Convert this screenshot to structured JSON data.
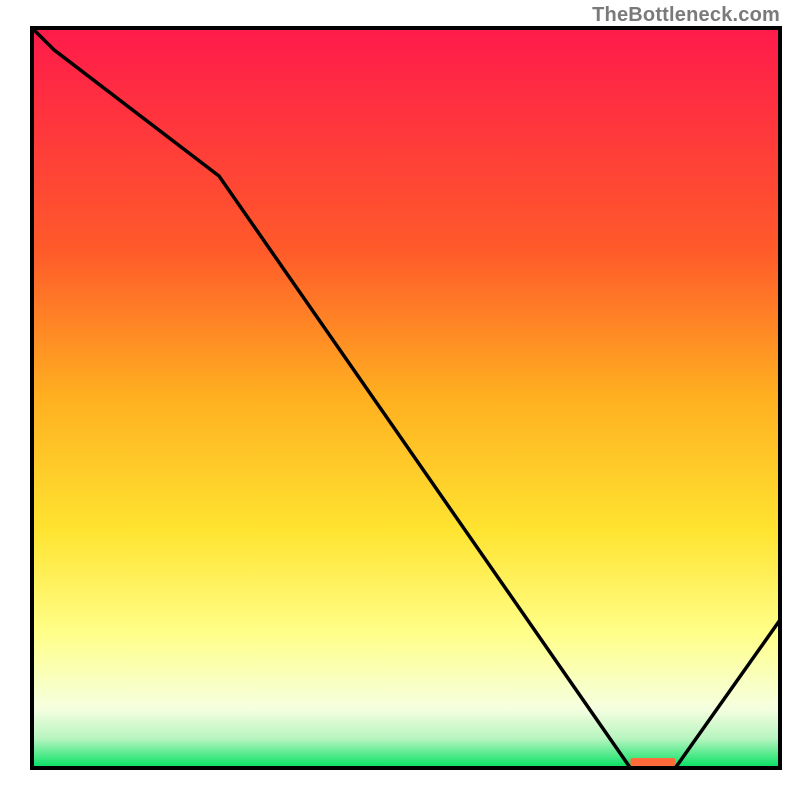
{
  "watermark": "TheBottleneck.com",
  "chart_data": {
    "type": "line",
    "title": "",
    "xlabel": "",
    "ylabel": "",
    "xlim": [
      0,
      100
    ],
    "ylim": [
      0,
      100
    ],
    "x": [
      0,
      3,
      25,
      80,
      86,
      100
    ],
    "values": [
      100,
      97,
      80,
      0,
      0,
      20
    ],
    "baseline_marker": {
      "x_start": 80,
      "x_end": 86,
      "label": ""
    },
    "background_gradient": {
      "top": "#ff1a4b",
      "upper_mid": "#ff9a1f",
      "mid": "#ffe431",
      "lower_mid": "#ffff8a",
      "bottom": "#00e060"
    }
  }
}
